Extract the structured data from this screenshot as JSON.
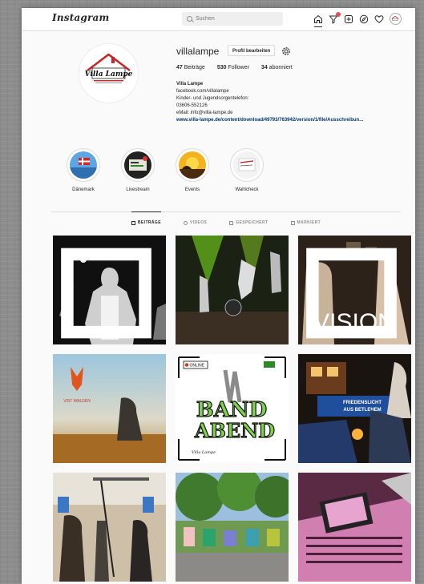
{
  "header": {
    "logo": "Instagram",
    "search_placeholder": "Suchen",
    "nav_icons": [
      "home-icon",
      "activity-filter-icon",
      "new-post-icon",
      "explore-icon",
      "heart-icon",
      "profile-avatar-icon"
    ]
  },
  "profile": {
    "username": "villalampe",
    "edit_label": "Profil bearbeiten",
    "stats": {
      "posts_count": "47",
      "posts_label": "Beiträge",
      "followers_count": "530",
      "followers_label": "Follower",
      "following_count": "34",
      "following_label": "abonniert"
    },
    "bio": {
      "name": "Villa Lampe",
      "line1": "facebook.com/villalampe",
      "line2": "Kinder- und Jugendsorgentelefon:",
      "line3": "03606-552126",
      "line4": "eMail: info@villa-lampe.de",
      "link": "www.villa-lampe.de/content/download/49793/763942/version/1/file/Ausschreibun..."
    },
    "avatar_text": "Villa Lampe"
  },
  "highlights": [
    {
      "label": "Dänemark"
    },
    {
      "label": "Livestream"
    },
    {
      "label": "Events"
    },
    {
      "label": "Wahlcheck"
    }
  ],
  "tabs": [
    {
      "label": "BEITRÄGE",
      "active": true
    },
    {
      "label": "VIDEOS",
      "active": false
    },
    {
      "label": "GESPEICHERT",
      "active": false
    },
    {
      "label": "MARKIERT",
      "active": false
    }
  ],
  "posts": {
    "p3_text": "VISION",
    "p4_text": "VIST WALDEN",
    "p5_line1": "BAND",
    "p5_line2": "ABEND",
    "p5_online": "ONLINE",
    "p5_logo": "Villa Lampe",
    "p6_banner1": "FRIEDENSLICHT",
    "p6_banner2": "AUS BETLEHEM"
  },
  "colors": {
    "accent": "#ed4956",
    "link": "#00376b",
    "border": "#dbdbdb"
  }
}
